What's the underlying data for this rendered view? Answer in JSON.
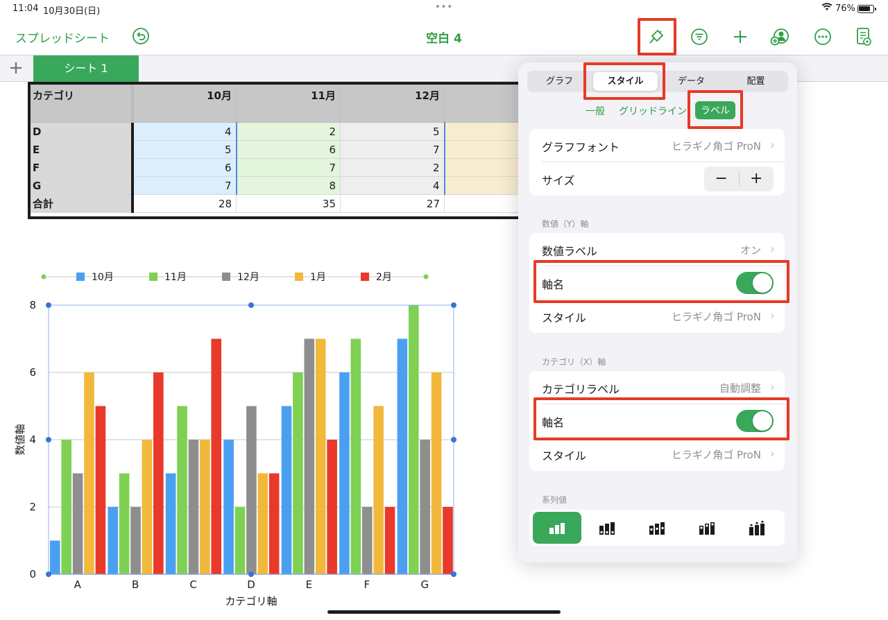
{
  "status_bar": {
    "time": "11:04",
    "date": "10月30日(日)",
    "battery": "76%"
  },
  "toolbar": {
    "back_label": "スプレッドシート",
    "document_title": "空白 4",
    "icons": [
      "undo-icon",
      "paintbrush-icon",
      "filter-icon",
      "plus-icon",
      "collaborate-icon",
      "more-icon",
      "reader-icon"
    ],
    "accent_color": "#2e9e44"
  },
  "sheet_tabs": {
    "add_label": "+",
    "tabs": [
      "シート 1"
    ]
  },
  "table": {
    "header": [
      "カテゴリ",
      "10月",
      "11月",
      "12月",
      ""
    ],
    "rows": [
      [
        "D",
        "4",
        "2",
        "5",
        ""
      ],
      [
        "E",
        "5",
        "6",
        "7",
        ""
      ],
      [
        "F",
        "6",
        "7",
        "2",
        ""
      ],
      [
        "G",
        "7",
        "8",
        "4",
        ""
      ]
    ],
    "total": [
      "合計",
      "28",
      "35",
      "27",
      ""
    ]
  },
  "chart_data": {
    "type": "bar",
    "title": "",
    "xlabel": "カテゴリ軸",
    "ylabel": "数値軸",
    "categories": [
      "A",
      "B",
      "C",
      "D",
      "E",
      "F",
      "G"
    ],
    "ylim": [
      0,
      8
    ],
    "yticks": [
      "0",
      "2",
      "4",
      "6",
      "8"
    ],
    "grid": true,
    "legend_position": "top",
    "series": [
      {
        "name": "10月",
        "color": "#4a9ff0",
        "values": [
          1,
          2,
          3,
          4,
          5,
          6,
          7
        ]
      },
      {
        "name": "11月",
        "color": "#7ed153",
        "values": [
          4,
          3,
          5,
          2,
          6,
          7,
          8
        ]
      },
      {
        "name": "12月",
        "color": "#8e8e8e",
        "values": [
          3,
          2,
          4,
          5,
          7,
          2,
          4
        ]
      },
      {
        "name": "1月",
        "color": "#f1b83c",
        "values": [
          6,
          4,
          4,
          3,
          7,
          5,
          6
        ]
      },
      {
        "name": "2月",
        "color": "#e8392b",
        "values": [
          5,
          6,
          7,
          3,
          4,
          2,
          2
        ]
      }
    ]
  },
  "popover": {
    "tabs": [
      "グラフ",
      "スタイル",
      "データ",
      "配置"
    ],
    "active_tab": "スタイル",
    "subtabs": [
      "一般",
      "グリッドライン",
      "ラベル"
    ],
    "active_subtab": "ラベル",
    "font_group": {
      "chart_font_label": "グラフフォント",
      "chart_font_value": "ヒラギノ角ゴ ProN",
      "size_label": "サイズ",
      "minus": "−",
      "plus": "+"
    },
    "value_axis": {
      "section": "数値（Y）軸",
      "value_labels_label": "数値ラベル",
      "value_labels_value": "オン",
      "axis_name_label": "軸名",
      "axis_name_on": true,
      "style_label": "スタイル",
      "style_value": "ヒラギノ角ゴ ProN"
    },
    "category_axis": {
      "section": "カテゴリ（X）軸",
      "category_labels_label": "カテゴリラベル",
      "category_labels_value": "自動調整",
      "axis_name_label": "軸名",
      "axis_name_on": true,
      "style_label": "スタイル",
      "style_value": "ヒラギノ角ゴ ProN"
    },
    "series_values": {
      "section": "系列値",
      "options": [
        "no-value-labels-icon",
        "value-labels-inside-bottom-icon",
        "value-labels-center-icon",
        "value-labels-inside-top-icon",
        "value-labels-outside-top-icon"
      ]
    }
  },
  "highlight_color": "#e53a24"
}
